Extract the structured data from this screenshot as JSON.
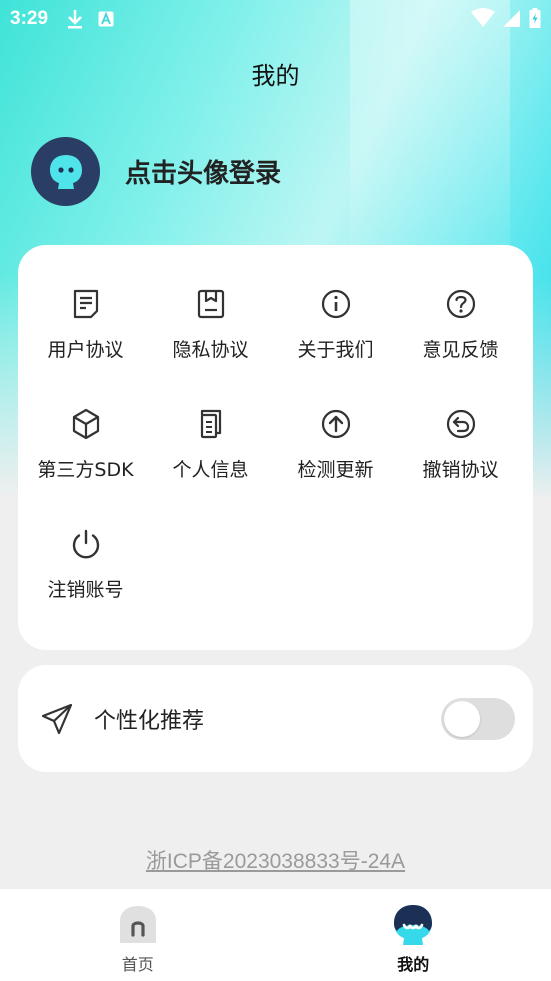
{
  "status_bar": {
    "time": "3:29",
    "icons": [
      "download-icon",
      "a-badge-icon",
      "wifi-icon",
      "signal-icon",
      "battery-charging-icon"
    ]
  },
  "header": {
    "title": "我的"
  },
  "profile": {
    "login_prompt": "点击头像登录",
    "avatar_icon": "mascot-icon"
  },
  "menu": {
    "items": [
      {
        "label": "用户协议",
        "icon": "document-icon"
      },
      {
        "label": "隐私协议",
        "icon": "privacy-document-icon"
      },
      {
        "label": "关于我们",
        "icon": "info-icon"
      },
      {
        "label": "意见反馈",
        "icon": "help-icon"
      },
      {
        "label": "第三方SDK",
        "icon": "cube-icon"
      },
      {
        "label": "个人信息",
        "icon": "files-icon"
      },
      {
        "label": "检测更新",
        "icon": "upload-arrow-icon"
      },
      {
        "label": "撤销协议",
        "icon": "undo-icon"
      },
      {
        "label": "注销账号",
        "icon": "power-icon"
      }
    ]
  },
  "recommend": {
    "label": "个性化推荐",
    "icon": "send-icon",
    "enabled": false
  },
  "footer": {
    "icp": "浙ICP备2023038833号-24A"
  },
  "bottom_nav": {
    "tabs": [
      {
        "label": "首页",
        "icon": "home-icon",
        "active": false
      },
      {
        "label": "我的",
        "icon": "mascot-icon",
        "active": true
      }
    ]
  },
  "colors": {
    "avatar_bg": "#2a3d64",
    "accent_cyan": "#3fe3d8",
    "toggle_off": "#dedede"
  }
}
